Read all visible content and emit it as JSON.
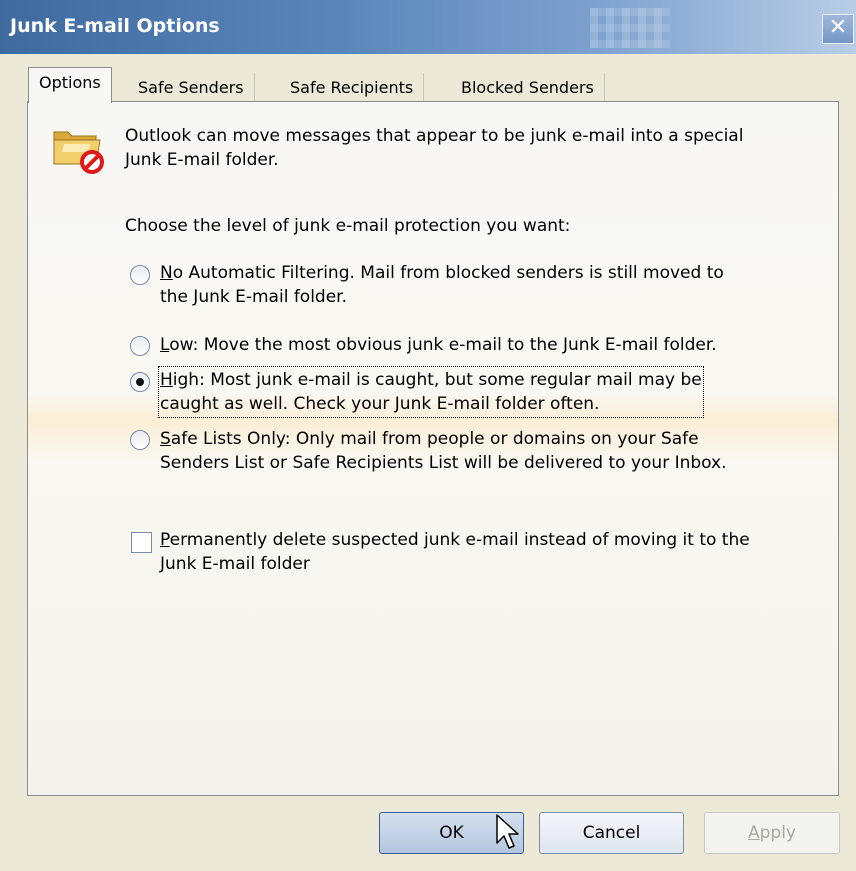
{
  "window": {
    "title": "Junk E-mail Options"
  },
  "tabs": [
    {
      "label": "Options"
    },
    {
      "label": "Safe Senders"
    },
    {
      "label": "Safe Recipients"
    },
    {
      "label": "Blocked Senders"
    }
  ],
  "intro": {
    "line1": "Outlook can move messages that appear to be junk e-mail into a special",
    "line2": "Junk E-mail folder."
  },
  "prompt": "Choose the level of junk e-mail protection you want:",
  "options": [
    {
      "key": "N",
      "line1_rest": "o Automatic Filtering.  Mail from blocked senders is still moved to",
      "line2": "the Junk E-mail folder.",
      "selected": false
    },
    {
      "key": "L",
      "line1_rest": "ow: Move the most obvious junk e-mail to the Junk E-mail folder.",
      "line2": "",
      "selected": false
    },
    {
      "key": "H",
      "line1_rest": "igh: Most junk e-mail is caught, but some regular mail may be",
      "line2": "caught as well. Check your Junk E-mail folder often.",
      "selected": true
    },
    {
      "key": "S",
      "line1_rest": "afe Lists Only: Only mail from people or domains on your Safe",
      "line2": "Senders List or Safe Recipients List will be delivered to your Inbox.",
      "selected": false
    }
  ],
  "permanent_delete": {
    "key": "P",
    "line1_rest": "ermanently delete suspected junk e-mail instead of moving it to the",
    "line2": "Junk E-mail folder",
    "checked": false
  },
  "buttons": {
    "ok": "OK",
    "cancel": "Cancel",
    "apply_key": "A",
    "apply_rest": "pply"
  },
  "icons": {
    "close": "close-icon",
    "folder": "junk-folder-icon",
    "cursor": "mouse-pointer-icon"
  },
  "colors": {
    "titlebar": "#3f6aa0",
    "dialog_bg": "#ece9d8",
    "panel_bg": "#f7f7f4",
    "prohibit_red": "#e01818"
  }
}
